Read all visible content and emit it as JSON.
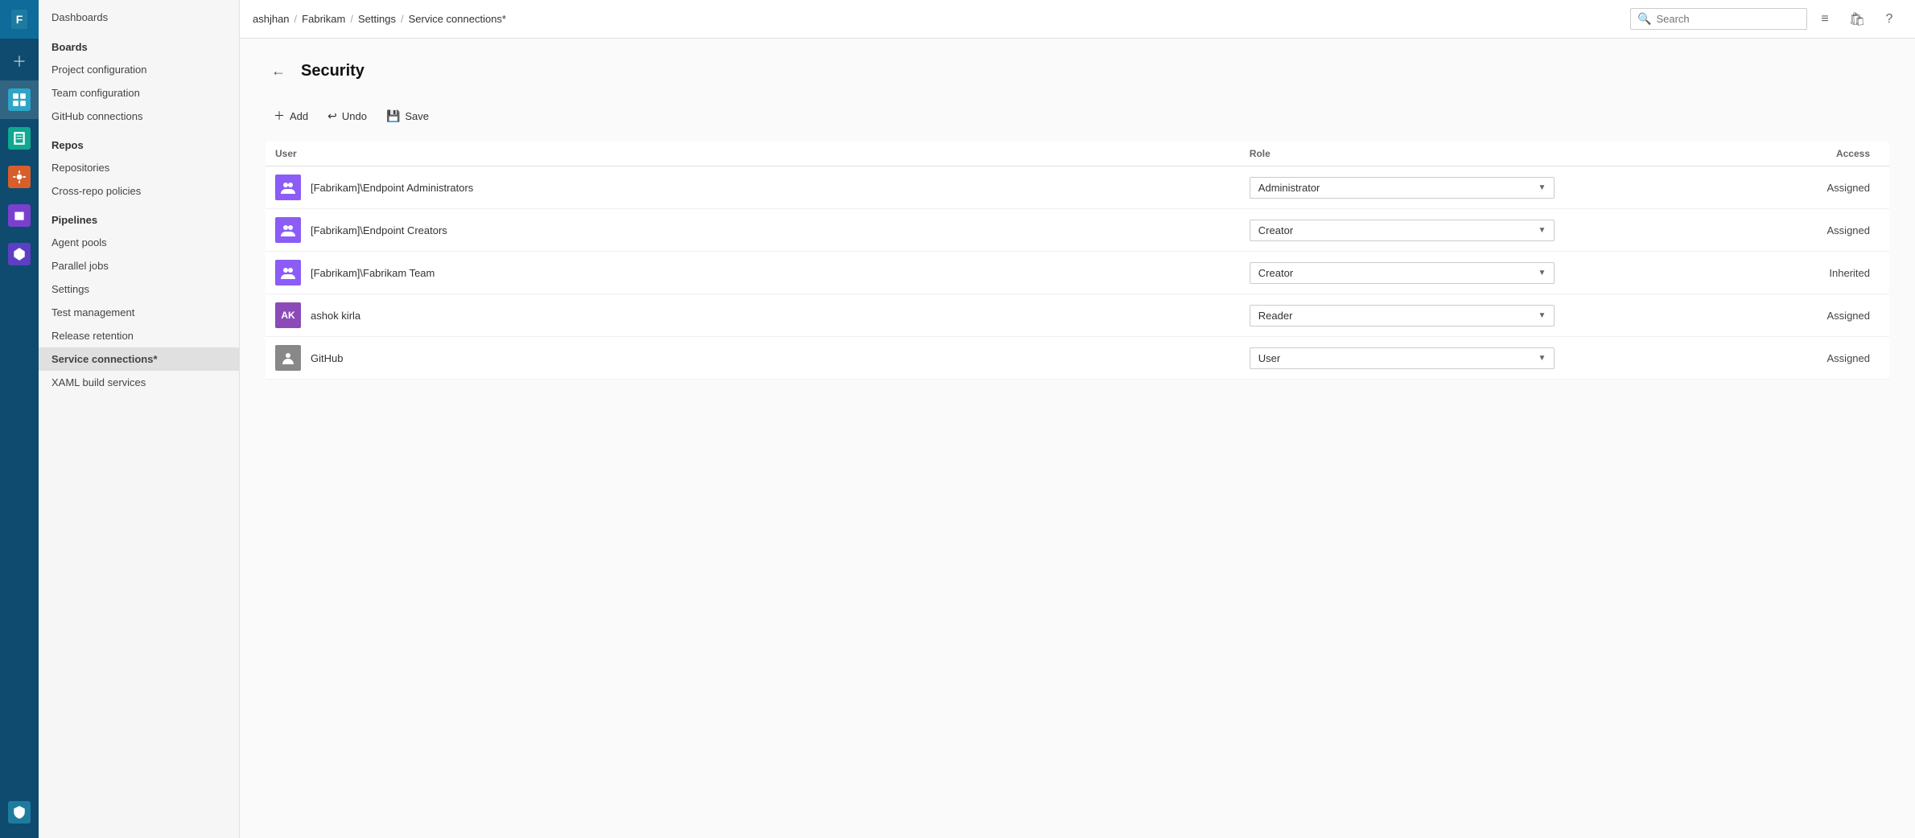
{
  "topbar": {
    "breadcrumbs": [
      "ashjhan",
      "Fabrikam",
      "Settings",
      "Service connections*"
    ],
    "search_placeholder": "Search"
  },
  "sidebar": {
    "dashboards_label": "Dashboards",
    "sections": [
      {
        "header": "Boards",
        "items": [
          "Project configuration",
          "Team configuration",
          "GitHub connections"
        ]
      },
      {
        "header": "Repos",
        "items": [
          "Repositories",
          "Cross-repo policies"
        ]
      },
      {
        "header": "Pipelines",
        "items": [
          "Agent pools",
          "Parallel jobs",
          "Settings",
          "Test management",
          "Release retention",
          "Service connections*",
          "XAML build services"
        ]
      }
    ]
  },
  "page": {
    "title": "Security",
    "back_label": "←"
  },
  "toolbar": {
    "add_label": "Add",
    "undo_label": "Undo",
    "save_label": "Save"
  },
  "table": {
    "headers": {
      "user": "User",
      "role": "Role",
      "access": "Access"
    },
    "rows": [
      {
        "avatar_type": "group",
        "avatar_text": "👥",
        "name": "[Fabrikam]\\Endpoint Administrators",
        "role": "Administrator",
        "access": "Assigned"
      },
      {
        "avatar_type": "group",
        "avatar_text": "👥",
        "name": "[Fabrikam]\\Endpoint Creators",
        "role": "Creator",
        "access": "Assigned"
      },
      {
        "avatar_type": "group",
        "avatar_text": "👥",
        "name": "[Fabrikam]\\Fabrikam Team",
        "role": "Creator",
        "access": "Inherited"
      },
      {
        "avatar_type": "initials",
        "avatar_text": "AK",
        "name": "ashok kirla",
        "role": "Reader",
        "access": "Assigned"
      },
      {
        "avatar_type": "github",
        "avatar_text": "⬡",
        "name": "GitHub",
        "role": "User",
        "access": "Assigned"
      }
    ]
  },
  "rail_icons": [
    {
      "name": "overview",
      "symbol": "🏠"
    },
    {
      "name": "boards",
      "symbol": "📋"
    },
    {
      "name": "repos",
      "symbol": "📁"
    },
    {
      "name": "pipelines",
      "symbol": "⚡"
    },
    {
      "name": "testplans",
      "symbol": "🧪"
    },
    {
      "name": "artifacts",
      "symbol": "📦"
    },
    {
      "name": "shieldcheck",
      "symbol": "🛡"
    }
  ]
}
